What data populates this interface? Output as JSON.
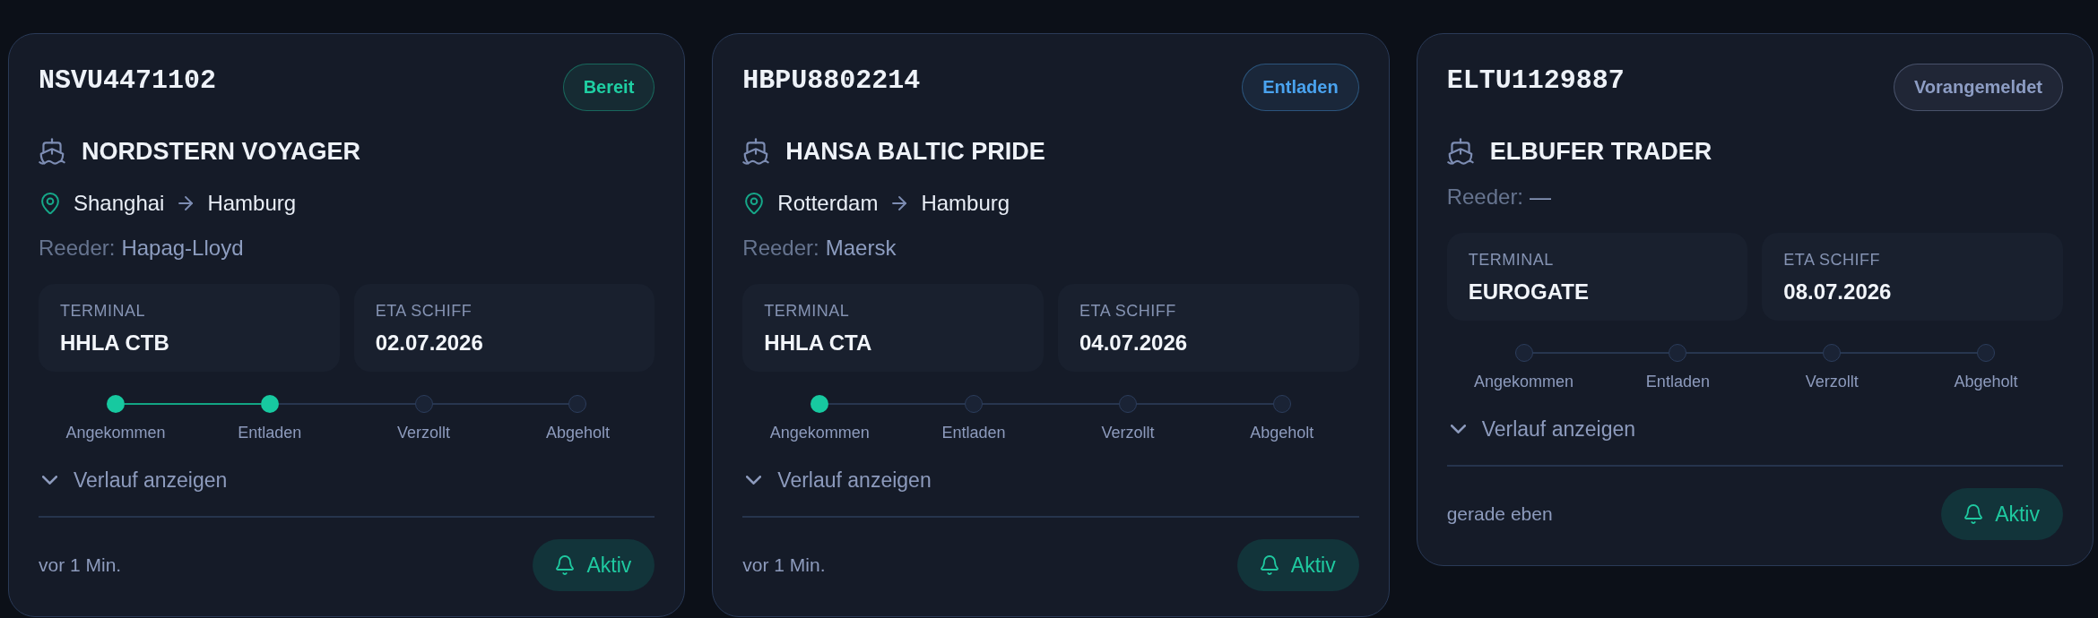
{
  "cards": [
    {
      "container_id": "NSVU4471102",
      "status": {
        "label": "Bereit",
        "color": "#1fcfa3"
      },
      "vessel": "NORDSTERN VOYAGER",
      "route": {
        "origin": "Shanghai",
        "destination": "Hamburg"
      },
      "owner_label": "Reeder:",
      "owner": "Hapag-Lloyd",
      "fields": [
        {
          "label": "TERMINAL",
          "value": "HHLA CTB"
        },
        {
          "label": "ETA SCHIFF",
          "value": "02.07.2026"
        }
      ],
      "steps": [
        {
          "label": "Angekommen",
          "done": true
        },
        {
          "label": "Entladen",
          "done": true
        },
        {
          "label": "Verzollt",
          "done": false
        },
        {
          "label": "Abgeholt",
          "done": false
        }
      ],
      "history_toggle": {
        "label": "Verlauf anzeigen",
        "expanded": false
      },
      "updated": "vor 1 Min.",
      "alert": {
        "label": "Aktiv",
        "on": true
      }
    },
    {
      "container_id": "HBPU8802214",
      "status": {
        "label": "Entladen",
        "color": "#4aa3ef"
      },
      "vessel": "HANSA BALTIC PRIDE",
      "route": {
        "origin": "Rotterdam",
        "destination": "Hamburg"
      },
      "owner_label": "Reeder:",
      "owner": "Maersk",
      "fields": [
        {
          "label": "TERMINAL",
          "value": "HHLA CTA"
        },
        {
          "label": "ETA SCHIFF",
          "value": "04.07.2026"
        }
      ],
      "steps": [
        {
          "label": "Angekommen",
          "done": true
        },
        {
          "label": "Entladen",
          "done": false
        },
        {
          "label": "Verzollt",
          "done": false
        },
        {
          "label": "Abgeholt",
          "done": false
        }
      ],
      "history_toggle": {
        "label": "Verlauf anzeigen",
        "expanded": false
      },
      "updated": "vor 1 Min.",
      "alert": {
        "label": "Aktiv",
        "on": true
      }
    },
    {
      "container_id": "ELTU1129887",
      "status": {
        "label": "Vorangemeldet",
        "color": "#8d9dc4"
      },
      "vessel": "ELBUFER TRADER",
      "owner_label": "Reeder:",
      "owner": "—",
      "fields": [
        {
          "label": "TERMINAL",
          "value": "EUROGATE"
        },
        {
          "label": "ETA SCHIFF",
          "value": "08.07.2026"
        }
      ],
      "steps": [
        {
          "label": "Angekommen",
          "done": false
        },
        {
          "label": "Entladen",
          "done": false
        },
        {
          "label": "Verzollt",
          "done": false
        },
        {
          "label": "Abgeholt",
          "done": false
        }
      ],
      "history_toggle": {
        "label": "Verlauf anzeigen",
        "expanded": false
      },
      "updated": "gerade eben",
      "alert": {
        "label": "Aktiv",
        "on": true
      }
    }
  ]
}
